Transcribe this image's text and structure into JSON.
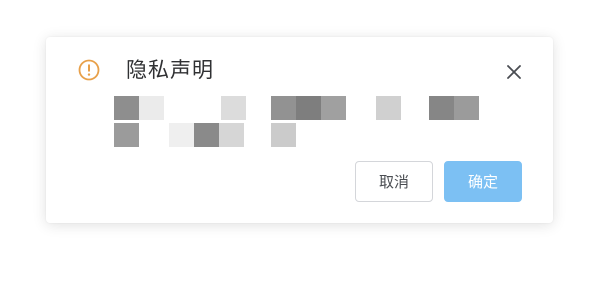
{
  "dialog": {
    "title": "隐私声明",
    "cancel_label": "取消",
    "confirm_label": "确定",
    "icons": {
      "warning": "warning-circle-icon",
      "close": "close-icon"
    },
    "colors": {
      "warning": "#e8a049",
      "confirm_bg": "#7cc0f3",
      "title": "#303133"
    }
  }
}
